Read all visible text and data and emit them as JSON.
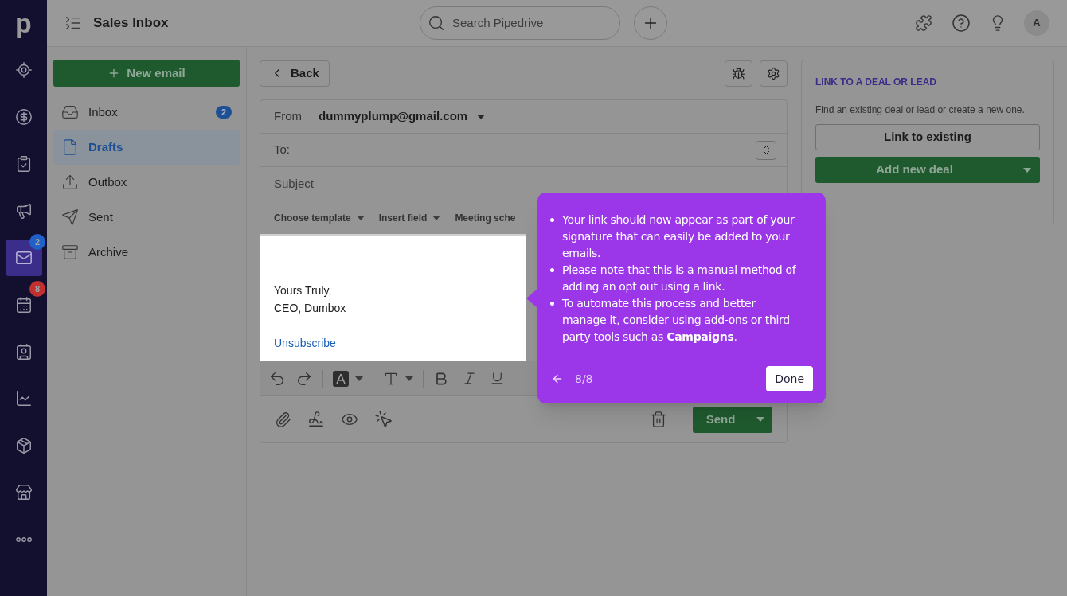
{
  "header": {
    "title": "Sales Inbox",
    "search": {
      "placeholder": "Search Pipedrive"
    },
    "avatar": "A"
  },
  "nav": [
    {
      "kind": "logo",
      "label": "p"
    },
    {
      "kind": "target",
      "selected": false
    },
    {
      "kind": "dollar",
      "selected": false
    },
    {
      "kind": "clipboard",
      "selected": false
    },
    {
      "kind": "megaphone",
      "selected": false
    },
    {
      "kind": "mail",
      "selected": true,
      "badge": "2",
      "color": "#2060c8"
    },
    {
      "kind": "calendar",
      "selected": false,
      "badge": "8",
      "color": "#c03030"
    },
    {
      "kind": "contacts",
      "selected": false
    },
    {
      "kind": "chart",
      "selected": false
    },
    {
      "kind": "box",
      "selected": false
    },
    {
      "kind": "store",
      "selected": false
    },
    {
      "kind": "more",
      "selected": false
    }
  ],
  "new_email": "New email",
  "folders": [
    {
      "kind": "inbox",
      "label": "Inbox",
      "count": "2",
      "selected": false
    },
    {
      "kind": "drafts",
      "label": "Drafts",
      "selected": true
    },
    {
      "kind": "outbox",
      "label": "Outbox",
      "selected": false
    },
    {
      "kind": "sent",
      "label": "Sent",
      "selected": false
    },
    {
      "kind": "archive",
      "label": "Archive",
      "selected": false
    }
  ],
  "back": "Back",
  "composer": {
    "from_label": "From",
    "from_value": "dummyplump@gmail.com",
    "to_label": "To:",
    "subject_placeholder": "Subject",
    "toolbar": [
      "Choose template",
      "Insert field",
      "Meeting sche"
    ],
    "body": [
      "Yours Truly,",
      "CEO, Dumbox"
    ],
    "link": "Unsubscribe",
    "send": "Send"
  },
  "link_panel": {
    "title": "LINK TO A DEAL OR LEAD",
    "text": "Find an existing deal or lead or create a new one.",
    "link_existing": "Link to existing",
    "add_deal": "Add new deal"
  },
  "tooltip": {
    "bullets": [
      "Your link should now appear as part of your signature that can easily be added to your emails.",
      "Please note that this is a manual method of adding an opt out using a link.",
      "To automate this process and better manage it, consider using add-ons or third party tools such as **Campaigns**."
    ],
    "step": "8/8",
    "done": "Done"
  }
}
